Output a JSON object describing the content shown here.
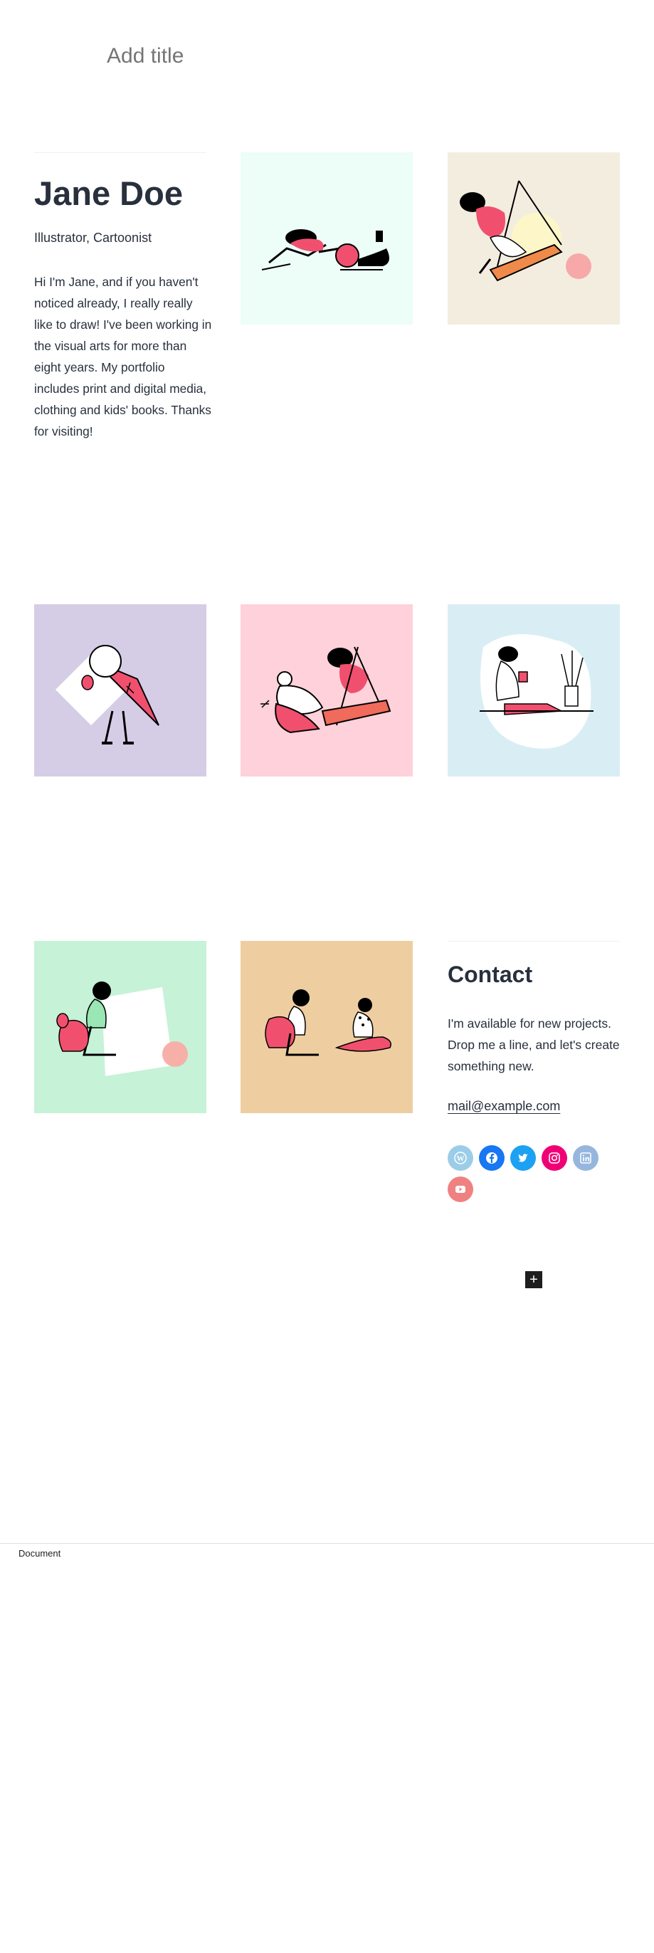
{
  "page": {
    "title_placeholder": "Add title"
  },
  "profile": {
    "name": "Jane Doe",
    "role": "Illustrator, Cartoonist",
    "bio": "Hi I'm Jane, and if you haven't noticed already, I really really like to draw! I've been working in the visual arts for more than eight years. My portfolio includes print and digital media, clothing and kids' books. Thanks for visiting!"
  },
  "gallery": [
    {
      "label": "illustration-running-people",
      "bg": "#edfdf8"
    },
    {
      "label": "illustration-woman-on-swing",
      "bg": "#f3ede0"
    },
    {
      "label": "illustration-ice-cream",
      "bg": "#d5cde6"
    },
    {
      "label": "illustration-swing-and-friend",
      "bg": "#ffd1da"
    },
    {
      "label": "illustration-woman-reading",
      "bg": "#d9eef4"
    },
    {
      "label": "illustration-woman-with-dog",
      "bg": "#c6f2d7"
    },
    {
      "label": "illustration-friends-sitting",
      "bg": "#eecea0"
    }
  ],
  "contact": {
    "heading": "Contact",
    "text": "I'm available for new projects. Drop me a line, and let's create something new.",
    "email": "mail@example.com"
  },
  "social": [
    {
      "name": "wordpress-icon",
      "color": "#9ccde8"
    },
    {
      "name": "facebook-icon",
      "color": "#1877f2"
    },
    {
      "name": "twitter-icon",
      "color": "#1da1f2"
    },
    {
      "name": "instagram-icon",
      "color": "#f00075"
    },
    {
      "name": "linkedin-icon",
      "color": "#96b6de"
    },
    {
      "name": "youtube-icon",
      "color": "#f08181"
    }
  ],
  "editor": {
    "add_block_symbol": "+",
    "footer_label": "Document"
  }
}
